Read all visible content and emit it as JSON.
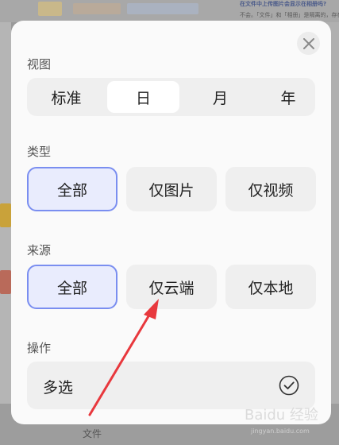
{
  "background": {
    "headline": "在文件中上传图片会显示在相册吗?",
    "snippet": "不会。「文件」和「相册」是隔离的，存在",
    "bottom_label": "文件"
  },
  "modal": {
    "close_icon": "close-icon",
    "view": {
      "title": "视图",
      "options": [
        "标准",
        "日",
        "月",
        "年"
      ],
      "selected": "日"
    },
    "type": {
      "title": "类型",
      "options": [
        "全部",
        "仅图片",
        "仅视频"
      ],
      "selected": "全部"
    },
    "source": {
      "title": "来源",
      "options": [
        "全部",
        "仅云端",
        "仅本地"
      ],
      "selected": "全部"
    },
    "operation": {
      "title": "操作",
      "item_label": "多选",
      "item_icon": "check-circle-icon"
    }
  },
  "annotation": {
    "arrow_color": "#e8383d"
  },
  "watermark": {
    "brand": "Baidu 经验",
    "url": "jingyan.baidu.com"
  },
  "colors": {
    "accent": "#7a8ef0",
    "selected_fill": "#e9ecfd"
  }
}
